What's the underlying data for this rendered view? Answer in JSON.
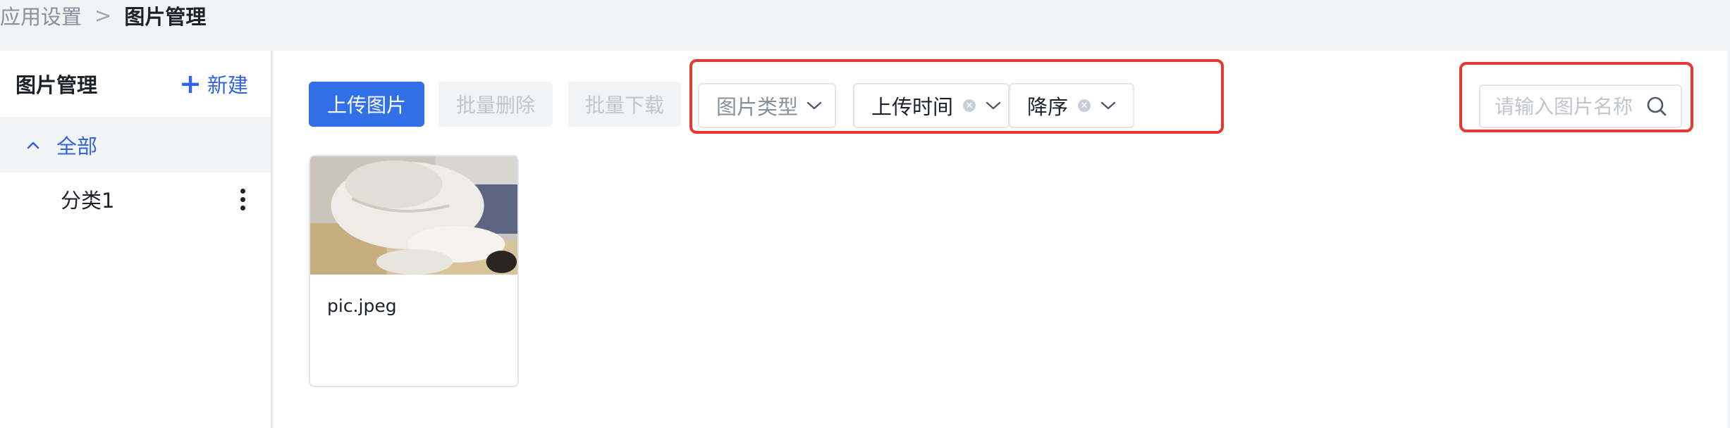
{
  "breadcrumb": {
    "root": "应用设置",
    "separator": ">",
    "current": "图片管理"
  },
  "sidebar": {
    "title": "图片管理",
    "new_label": "新建",
    "tree": {
      "all_label": "全部",
      "items": [
        {
          "label": "分类1"
        }
      ]
    }
  },
  "toolbar": {
    "upload_label": "上传图片",
    "batch_delete_label": "批量删除",
    "batch_download_label": "批量下载"
  },
  "filters": {
    "type": {
      "placeholder": "图片类型"
    },
    "time": {
      "value": "上传时间"
    },
    "order": {
      "value": "降序"
    }
  },
  "search": {
    "placeholder": "请输入图片名称"
  },
  "images": [
    {
      "name": "pic.jpeg"
    }
  ],
  "colors": {
    "primary": "#3370e8",
    "highlight": "#e5382f",
    "link": "#3162e8"
  },
  "icons": [
    "plus-icon",
    "caret-up-icon",
    "more-icon",
    "chevron-down-icon",
    "clear-icon",
    "search-icon"
  ]
}
